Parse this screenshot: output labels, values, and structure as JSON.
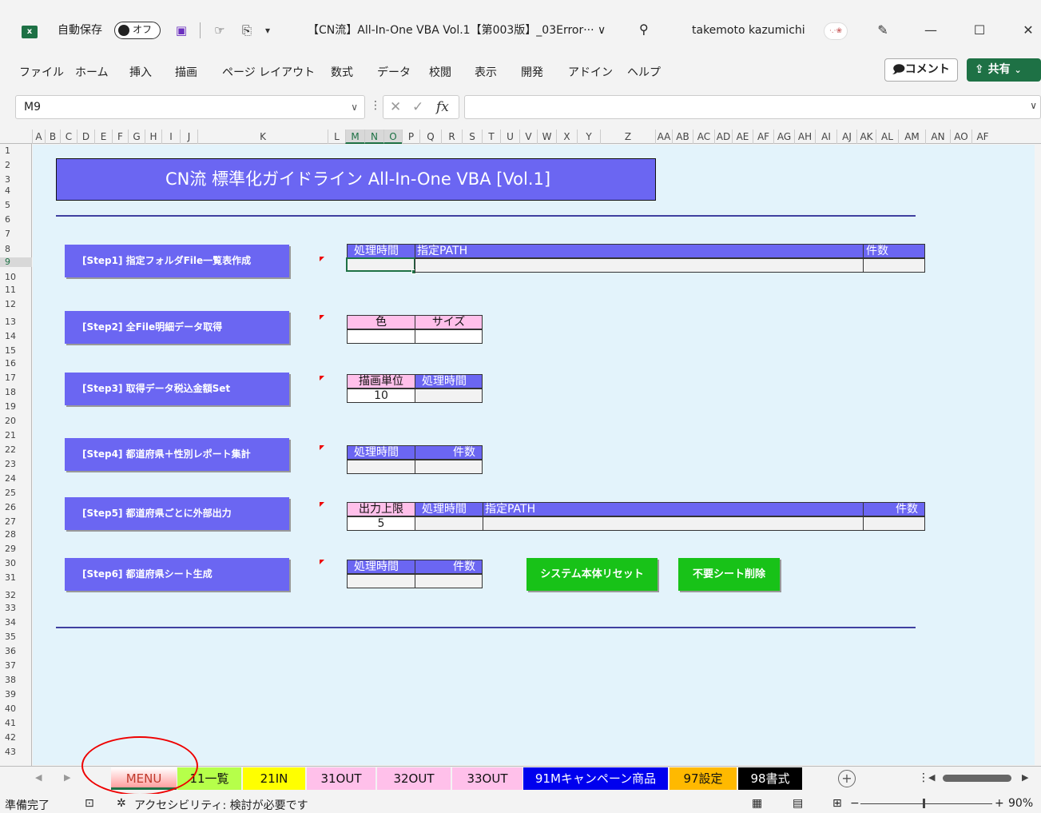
{
  "titlebar": {
    "app_icon": "x",
    "autosave_label": "自動保存",
    "autosave_state": "オフ",
    "doc_title": "【CN流】All-In-One VBA Vol.1【第003版】_03Error··· ∨",
    "user_name": "takemoto kazumichi",
    "avatar_text": "·.·❀",
    "icons": [
      "save-icon",
      "touch-mode-icon",
      "customize-icon",
      "search-icon",
      "pen-icon"
    ]
  },
  "ribbon": {
    "menu": [
      "ファイル",
      "ホーム",
      "挿入",
      "描画",
      "ページ レイアウト",
      "数式",
      "データ",
      "校閲",
      "表示",
      "開発",
      "アドイン",
      "ヘルプ"
    ],
    "comment_label": "コメント",
    "share_label": "共有"
  },
  "formula_bar": {
    "name_box": "M9",
    "fx": "fx",
    "formula": ""
  },
  "columns": [
    "A",
    "B",
    "C",
    "D",
    "E",
    "F",
    "G",
    "H",
    "I",
    "J",
    "K",
    "L",
    "M",
    "N",
    "O",
    "P",
    "Q",
    "R",
    "S",
    "T",
    "U",
    "V",
    "W",
    "X",
    "Y",
    "Z",
    "AA",
    "AB",
    "AC",
    "AD",
    "AE",
    "AF",
    "AG",
    "AH",
    "AI",
    "AJ",
    "AK",
    "AL",
    "AM",
    "AN",
    "AO",
    "AF"
  ],
  "rows": [
    "1",
    "2",
    "3",
    "4",
    "5",
    "6",
    "7",
    "8",
    "9",
    "10",
    "11",
    "12",
    "13",
    "14",
    "15",
    "16",
    "17",
    "18",
    "19",
    "20",
    "21",
    "22",
    "23",
    "24",
    "25",
    "26",
    "27",
    "28",
    "29",
    "30",
    "31",
    "32",
    "33",
    "34",
    "35",
    "36",
    "37",
    "38",
    "39",
    "40",
    "41",
    "42",
    "43"
  ],
  "sheet": {
    "banner": "CN流 標準化ガイドライン  All-In-One VBA [Vol.1]",
    "steps": [
      "[Step1] 指定フォルダFile一覧表作成",
      "[Step2] 全File明細データ取得",
      "[Step3] 取得データ税込金額Set",
      "[Step4] 都道府県＋性別レポート集計",
      "[Step5] 都道府県ごとに外部出力",
      "[Step6] 都道府県シート生成"
    ],
    "t1": {
      "h1": "処理時間",
      "h2": "指定PATH",
      "h3": "件数"
    },
    "t2": {
      "h1": "色",
      "h2": "サイズ"
    },
    "t3": {
      "h1": "描画単位",
      "h2": "処理時間",
      "v1": "10"
    },
    "t4": {
      "h1": "処理時間",
      "h2": "件数"
    },
    "t5": {
      "h1": "出力上限",
      "h2": "処理時間",
      "h3": "指定PATH",
      "h4": "件数",
      "v1": "5"
    },
    "t6": {
      "h1": "処理時間",
      "h2": "件数"
    },
    "reset_btn": "システム本体リセット",
    "delete_btn": "不要シート削除"
  },
  "tabs": [
    {
      "label": "MENU",
      "color": "#ff9f9f"
    },
    {
      "label": "11一覧",
      "color": "#b6ff4a"
    },
    {
      "label": "21IN",
      "color": "#ffff00"
    },
    {
      "label": "31OUT",
      "color": "#ffc0ea"
    },
    {
      "label": "32OUT",
      "color": "#ffc0ea"
    },
    {
      "label": "33OUT",
      "color": "#ffc0ea"
    },
    {
      "label": "91Mキャンペーン商品",
      "color": "#0000ee"
    },
    {
      "label": "97設定",
      "color": "#ffb900"
    },
    {
      "label": "98書式",
      "color": "#000000"
    }
  ],
  "status": {
    "ready": "準備完了",
    "accessibility": "アクセシビリティ: 検討が必要です",
    "zoom": "90%"
  }
}
